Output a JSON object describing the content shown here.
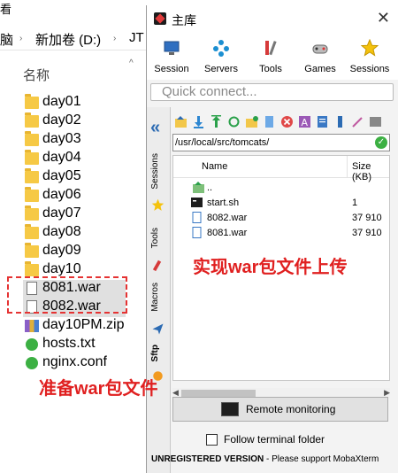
{
  "explorer": {
    "menu_label": "看",
    "address": {
      "computer": "脑",
      "drive": "新加卷 (D:)",
      "folder": "JT"
    },
    "column_header": "名称",
    "items": [
      {
        "name": "day01",
        "type": "folder"
      },
      {
        "name": "day02",
        "type": "folder"
      },
      {
        "name": "day03",
        "type": "folder"
      },
      {
        "name": "day04",
        "type": "folder"
      },
      {
        "name": "day05",
        "type": "folder"
      },
      {
        "name": "day06",
        "type": "folder"
      },
      {
        "name": "day07",
        "type": "folder"
      },
      {
        "name": "day08",
        "type": "folder"
      },
      {
        "name": "day09",
        "type": "folder"
      },
      {
        "name": "day10",
        "type": "folder"
      },
      {
        "name": "8081.war",
        "type": "file"
      },
      {
        "name": "8082.war",
        "type": "file"
      },
      {
        "name": "day10PM.zip",
        "type": "zip"
      },
      {
        "name": "hosts.txt",
        "type": "text"
      },
      {
        "name": "nginx.conf",
        "type": "text"
      }
    ]
  },
  "annotations": {
    "upload_note": "实现war包文件上传",
    "prepare_note": "准备war包文件"
  },
  "moba": {
    "title": "主库",
    "toolbar": [
      "Session",
      "Servers",
      "Tools",
      "Games",
      "Sessions"
    ],
    "quick_connect_placeholder": "Quick connect...",
    "side_tabs": [
      "Sessions",
      "Tools",
      "Macros",
      "Sftp"
    ],
    "sftp": {
      "path": "/usr/local/src/tomcats/",
      "col_name": "Name",
      "col_size": "Size (KB)",
      "up_label": "..",
      "files": [
        {
          "name": "start.sh",
          "size": "1"
        },
        {
          "name": "8082.war",
          "size": "37 910"
        },
        {
          "name": "8081.war",
          "size": "37 910"
        }
      ],
      "remote_monitoring": "Remote monitoring",
      "follow_terminal": "Follow terminal folder"
    },
    "status_bold": "UNREGISTERED VERSION",
    "status_rest": " - Please support MobaXterm"
  },
  "colors": {
    "annotation_red": "#e53333",
    "folder_yellow": "#f6c945",
    "moba_blue": "#2c6bb3",
    "ok_green": "#3cb043"
  }
}
